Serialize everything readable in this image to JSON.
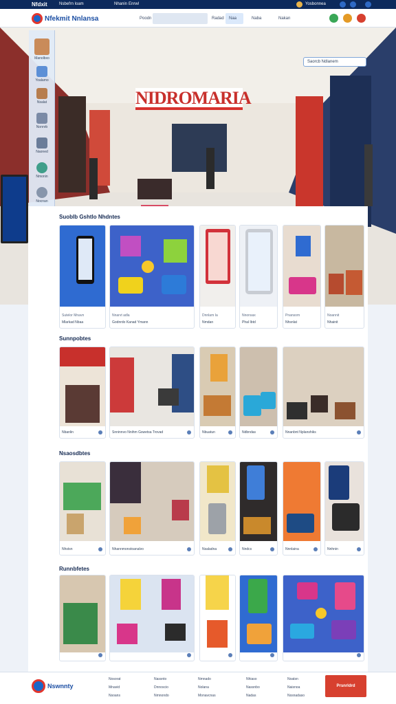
{
  "topbar": {
    "brand": "Nfdxit",
    "links": [
      "Nsbefrn loam",
      "Nhanin",
      "Enrwl"
    ],
    "right": "Yosbonnea"
  },
  "nav": {
    "logo": "Nfekmit Nnlansa",
    "links": [
      "Poodn",
      "Radad",
      "Naa",
      "Naba",
      "Nakan"
    ]
  },
  "hero": {
    "sign": "NIDROMARIA",
    "search_placeholder": "Saorcb Ndlanem"
  },
  "sidebar": {
    "items": [
      {
        "label": "Manolbxo",
        "icon": "avatar-icon"
      },
      {
        "label": "Yoalamo",
        "icon": "chat-icon"
      },
      {
        "label": "Nsalat",
        "icon": "user-icon"
      },
      {
        "label": "Nonnrb",
        "icon": "list-icon"
      },
      {
        "label": "Naoned",
        "icon": "grid-icon"
      },
      {
        "label": "Nmonin",
        "icon": "leaf-icon"
      },
      {
        "label": "Nocnan",
        "icon": "settings-icon"
      }
    ]
  },
  "sections": [
    {
      "title": "Suoblb Gshtlo Nhdntes",
      "cards": [
        {
          "caption": "Mlarkad Nbaa",
          "sub": "Sutelor Mnavn"
        },
        {
          "caption": "Godnrdo Kanad Ymann",
          "sub": "Nnarvt adla"
        },
        {
          "caption": "Nmdan",
          "sub": "Dnnlam Ia"
        },
        {
          "caption": "Phal Ibtd",
          "sub": "Nnonsax"
        },
        {
          "caption": "Nhsnlat",
          "sub": "Pnansom"
        },
        {
          "caption": "Nhainit",
          "sub": "Noannit"
        }
      ]
    },
    {
      "title": "Sunnpobtes",
      "cards": [
        {
          "caption": "Nbanlin",
          "sub": ""
        },
        {
          "caption": "Snninnvo Nnihm Gswetsa Trovad",
          "sub": ""
        },
        {
          "caption": "Nbuatun",
          "sub": ""
        },
        {
          "caption": "Ndbndas",
          "sub": ""
        },
        {
          "caption": "Nnanbnt Nplanshiks",
          "sub": ""
        }
      ]
    },
    {
      "title": "Nsaosdbtes",
      "cards": [
        {
          "caption": "Nhstsn",
          "sub": ""
        },
        {
          "caption": "Nhannmonstoanalvo",
          "sub": ""
        },
        {
          "caption": "Nsaladna",
          "sub": ""
        },
        {
          "caption": "Nndcs",
          "sub": ""
        },
        {
          "caption": "Nnnlaina",
          "sub": ""
        },
        {
          "caption": "Nnhnin",
          "sub": ""
        }
      ]
    },
    {
      "title": "Runnbfetes",
      "cards": [
        {
          "caption": "",
          "sub": ""
        },
        {
          "caption": "",
          "sub": ""
        },
        {
          "caption": "",
          "sub": ""
        },
        {
          "caption": "",
          "sub": ""
        },
        {
          "caption": "",
          "sub": ""
        }
      ]
    }
  ],
  "footer": {
    "logo": "Nswnnty",
    "columns": [
      [
        "Nosorat",
        "Mnavid",
        "Nsoans"
      ],
      [
        "Nassnto",
        "Dnnoscio",
        "Nmnondo"
      ],
      [
        "Nmnado",
        "Nolana",
        "Monavcnas"
      ],
      [
        "Nhiaso",
        "Nassnbo",
        "Nadas"
      ],
      [
        "Noatsn",
        "Naisnoa",
        "Nssnadaso"
      ]
    ],
    "cta": "Prsnrldrd"
  },
  "colors": {
    "navy": "#0d2a5c",
    "brand_blue": "#1b66c9",
    "accent_red": "#d7402f"
  }
}
